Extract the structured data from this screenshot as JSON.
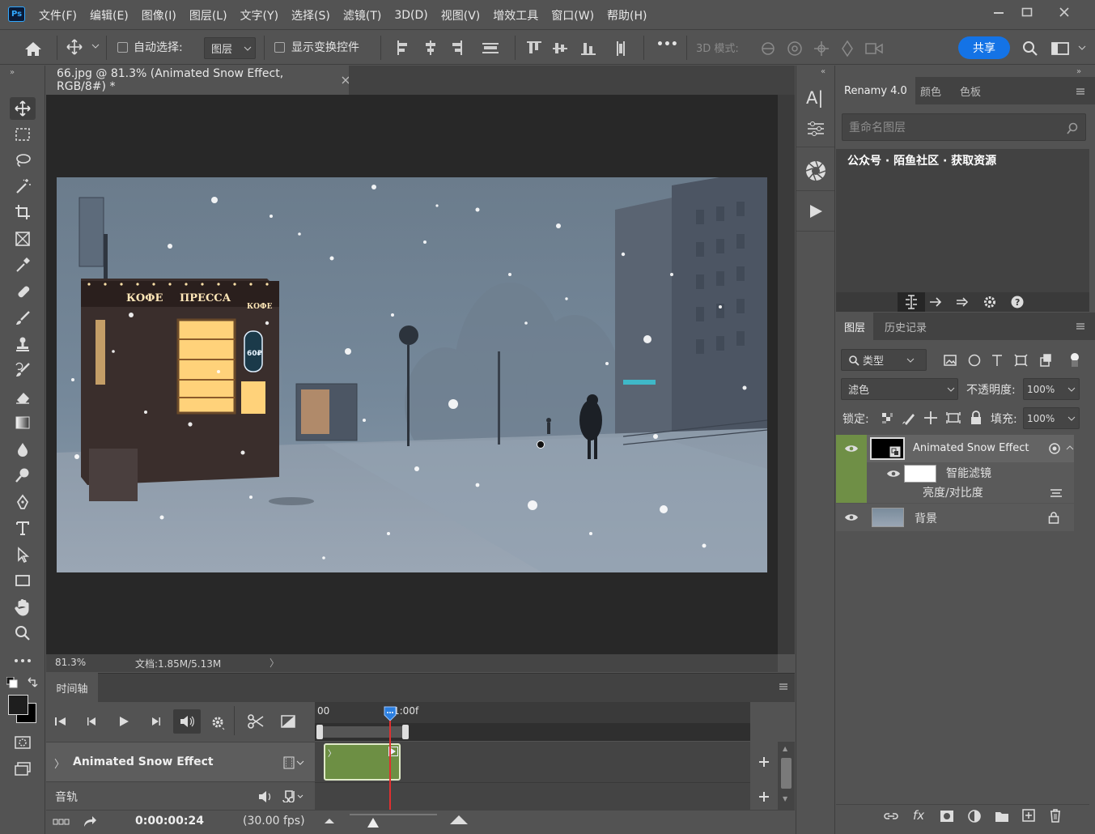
{
  "app": {
    "logo": "Ps"
  },
  "menubar": {
    "items": [
      "文件(F)",
      "编辑(E)",
      "图像(I)",
      "图层(L)",
      "文字(Y)",
      "选择(S)",
      "滤镜(T)",
      "3D(D)",
      "视图(V)",
      "增效工具",
      "窗口(W)",
      "帮助(H)"
    ]
  },
  "options": {
    "auto_select_label": "自动选择:",
    "auto_select_target": "图层",
    "show_transform_label": "显示变换控件",
    "more_label": "•••",
    "mode_3d_label": "3D 模式:",
    "share_label": "共享"
  },
  "document": {
    "tab_title": "66.jpg @ 81.3% (Animated Snow Effect, RGB/8#) *",
    "zoom": "81.3%",
    "doc_size": "文档:1.85M/5.13M",
    "sign_left_1": "КОФЕ",
    "sign_left_2": "ПРЕССА",
    "sign_left_3": "КОФЕ",
    "badge": "60₽"
  },
  "timeline": {
    "tab_label": "时间轴",
    "track_name": "Animated Snow Effect",
    "audio_label": "音轨",
    "ruler_start": "00",
    "ruler_mark": "1:00f",
    "current_time": "0:00:00:24",
    "fps": "(30.00 fps)",
    "playhead_fraction": 0.82
  },
  "renamy": {
    "tabs": [
      "Renamy 4.0",
      "颜色",
      "色板"
    ],
    "placeholder": "重命名图层",
    "banner": "公众号 · 陌鱼社区 · 获取资源"
  },
  "layers_panel": {
    "tabs": [
      "图层",
      "历史记录"
    ],
    "filter_kind": "类型",
    "blend_mode": "滤色",
    "opacity_label": "不透明度:",
    "opacity_value": "100%",
    "lock_label": "锁定:",
    "fill_label": "填充:",
    "fill_value": "100%",
    "layers": [
      {
        "name": "Animated Snow Effect",
        "selected": true
      },
      {
        "name": "智能滤镜"
      },
      {
        "name": "亮度/对比度"
      },
      {
        "name": "背景"
      }
    ]
  },
  "colors": {
    "accent": "#1473e6",
    "selected_layer": "#6f8f46",
    "clip_green": "#6d8f44",
    "playhead": "#e03030"
  }
}
